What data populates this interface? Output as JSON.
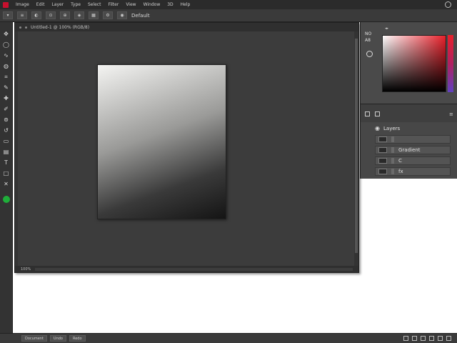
{
  "menubar": {
    "items": [
      "Image",
      "Edit",
      "Layer",
      "Type",
      "Select",
      "Filter",
      "View",
      "Window",
      "3D",
      "Help"
    ]
  },
  "optionsbar": {
    "label": "Default"
  },
  "document": {
    "tab_title": "Untitled-1 @ 100% (RGB/8)",
    "zoom": "100%"
  },
  "panels": {
    "color_tabs": [
      "NO",
      "A8"
    ],
    "layers": {
      "header": "Layers",
      "rows": [
        {
          "label": ""
        },
        {
          "label": "Gradient"
        },
        {
          "label": "C"
        },
        {
          "label": "fx"
        }
      ]
    }
  },
  "bottombar": {
    "buttons": [
      "Document",
      "Undo",
      "Redo"
    ]
  },
  "colors": {
    "foreground_swatch": "#1fae3a",
    "picker_hue": "#e8202a"
  },
  "icons": [
    "search-icon",
    "gear-icon",
    "eye-icon",
    "move-icon",
    "lasso-icon",
    "crop-icon",
    "brush-icon",
    "eraser-icon",
    "text-icon",
    "shape-icon",
    "zoom-icon"
  ]
}
